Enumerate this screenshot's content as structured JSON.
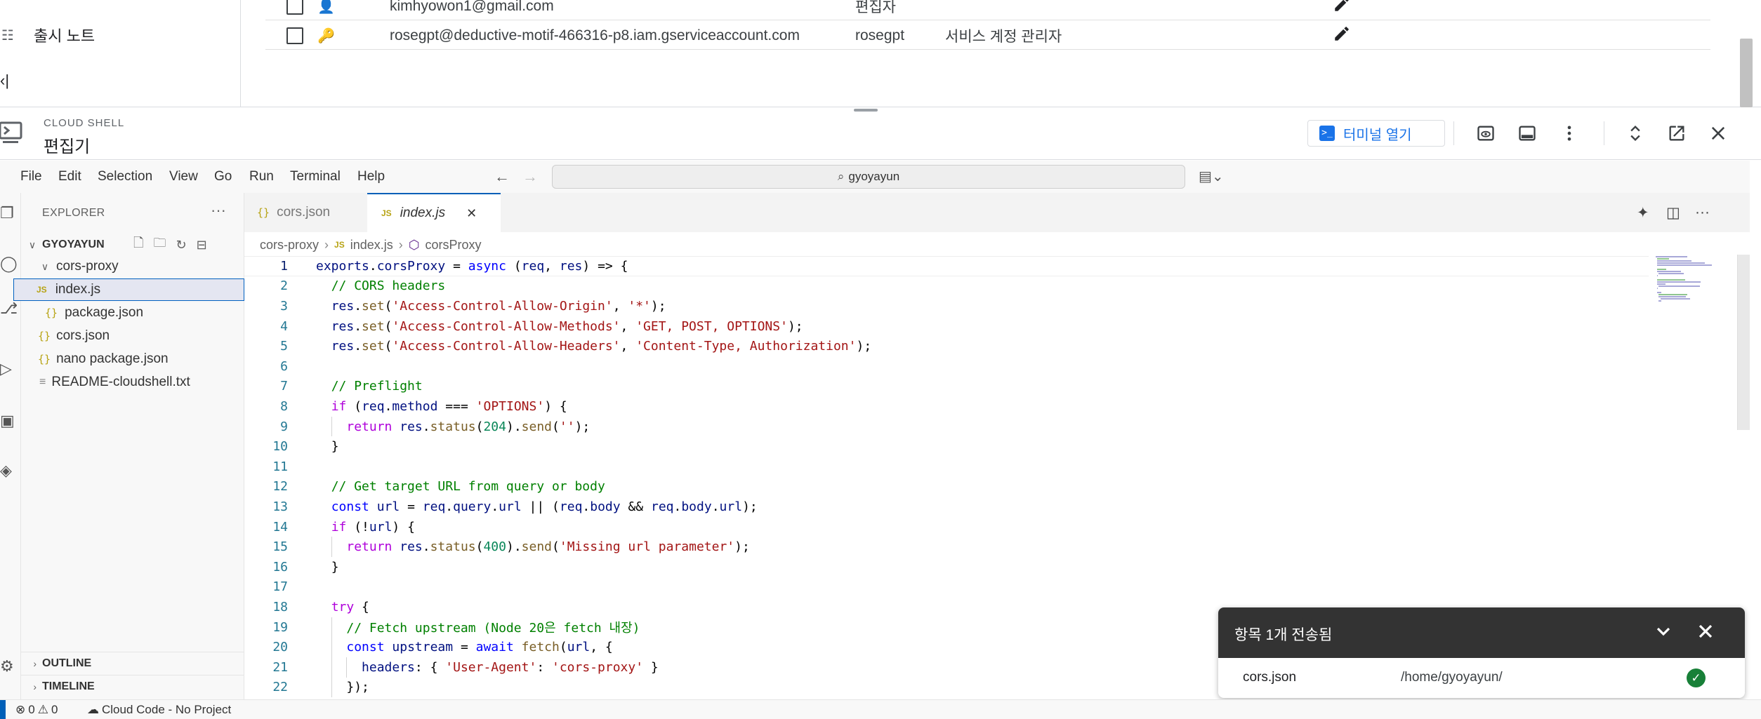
{
  "gc_sidebar": {
    "items": [
      {
        "label": "출시 노트"
      }
    ]
  },
  "iam_table": {
    "rows": [
      {
        "principal": "kimhyowon1@gmail.com",
        "name": "",
        "role": "편집자"
      },
      {
        "principal": "rosegpt@deductive-motif-466316-p8.iam.gserviceaccount.com",
        "name": "rosegpt",
        "role": "서비스 계정 관리자"
      }
    ]
  },
  "cloud_shell": {
    "subtitle": "CLOUD SHELL",
    "title": "편집기",
    "open_terminal_label": "터미널 열기"
  },
  "menubar": {
    "items": [
      "File",
      "Edit",
      "Selection",
      "View",
      "Go",
      "Run",
      "Terminal",
      "Help"
    ],
    "search_text": "gyoyayun"
  },
  "explorer": {
    "title": "EXPLORER",
    "workspace": "GYOYAYUN",
    "tree": [
      {
        "label": "cors-proxy",
        "type": "folder"
      },
      {
        "label": "index.js",
        "type": "js"
      },
      {
        "label": "package.json",
        "type": "json"
      },
      {
        "label": "cors.json",
        "type": "json"
      },
      {
        "label": "nano package.json",
        "type": "json"
      },
      {
        "label": "README-cloudshell.txt",
        "type": "txt"
      }
    ],
    "outline_label": "OUTLINE",
    "timeline_label": "TIMELINE"
  },
  "editor": {
    "tabs": [
      {
        "label": "cors.json",
        "active": false
      },
      {
        "label": "index.js",
        "active": true
      }
    ],
    "breadcrumb": [
      "cors-proxy",
      "index.js",
      "corsProxy"
    ],
    "current_line": 1,
    "code_lines": [
      "exports.corsProxy = async (req, res) => {",
      "  // CORS headers",
      "  res.set('Access-Control-Allow-Origin', '*');",
      "  res.set('Access-Control-Allow-Methods', 'GET, POST, OPTIONS');",
      "  res.set('Access-Control-Allow-Headers', 'Content-Type, Authorization');",
      "",
      "  // Preflight",
      "  if (req.method === 'OPTIONS') {",
      "    return res.status(204).send('');",
      "  }",
      "",
      "  // Get target URL from query or body",
      "  const url = req.query.url || (req.body && req.body.url);",
      "  if (!url) {",
      "    return res.status(400).send('Missing url parameter');",
      "  }",
      "",
      "  try {",
      "    // Fetch upstream (Node 20은 fetch 내장)",
      "    const upstream = await fetch(url, {",
      "      headers: { 'User-Agent': 'cors-proxy' }",
      "    });"
    ]
  },
  "notification": {
    "title": "항목 1개 전송됨",
    "file": "cors.json",
    "path": "/home/gyoyayun/"
  },
  "statusbar": {
    "errors": "0",
    "warnings": "0",
    "cloud_code": "Cloud Code - No Project"
  },
  "colors": {
    "accent": "#005fb8",
    "google_blue": "#1a73e8",
    "success_green": "#188038",
    "toast_header": "#333333"
  }
}
